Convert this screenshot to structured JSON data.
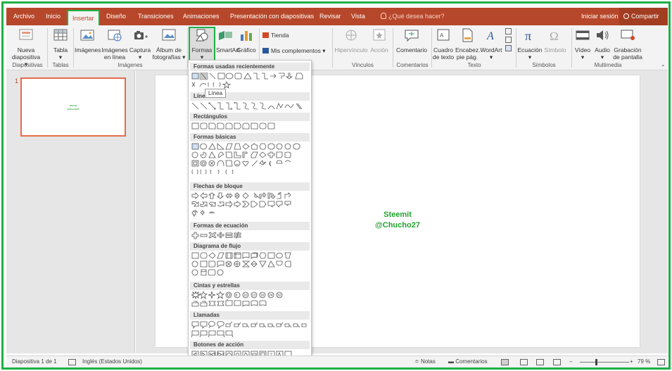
{
  "tabs": [
    "Archivo",
    "Inicio",
    "Insertar",
    "Diseño",
    "Transiciones",
    "Animaciones",
    "Presentación con diapositivas",
    "Revisar",
    "Vista"
  ],
  "active_tab": "Insertar",
  "tell_me": "¿Qué desea hacer?",
  "sign_in": "Iniciar sesión",
  "share": "Compartir",
  "ribbon": {
    "nueva": [
      "Nueva",
      "diapositiva ▾"
    ],
    "tabla": [
      "Tabla",
      "▾"
    ],
    "imagenes": "Imágenes",
    "imagenes_linea": [
      "Imágenes",
      "en línea"
    ],
    "captura": [
      "Captura",
      "▾"
    ],
    "album": [
      "Álbum de",
      "fotografías ▾"
    ],
    "formas": [
      "Formas",
      "▾"
    ],
    "smartart": "SmartArt",
    "grafico": "Gráfico",
    "tienda": "Tienda",
    "mis_complementos": "Mis complementos",
    "hipervinculo": "Hipervínculo",
    "accion": "Acción",
    "comentario": "Comentario",
    "cuadro_texto": [
      "Cuadro",
      "de texto"
    ],
    "encabez": [
      "Encabez.",
      "pie pág."
    ],
    "wordart": [
      "WordArt",
      "▾"
    ],
    "ecuacion": [
      "Ecuación",
      "▾"
    ],
    "simbolo": "Símbolo",
    "video": [
      "Vídeo",
      "▾"
    ],
    "audio": [
      "Audio",
      "▾"
    ],
    "grabacion": [
      "Grabación",
      "de pantalla"
    ],
    "groups": [
      "Diapositivas",
      "Tablas",
      "Imágenes",
      "Vínculos",
      "Comentarios",
      "Texto",
      "Símbolos",
      "Multimedia"
    ]
  },
  "slide_number": "1",
  "slide_text": [
    "Steemit",
    "@Chucho27"
  ],
  "shapes_menu": {
    "sections": [
      "Formas usadas recientemente",
      "Líneas",
      "Rectángulos",
      "Formas básicas",
      "Flechas de bloque",
      "Formas de ecuación",
      "Diagrama de flujo",
      "Cintas y estrellas",
      "Llamadas",
      "Botones de acción"
    ],
    "tooltip": "Línea"
  },
  "status": {
    "slide": "Diapositiva 1 de 1",
    "language": "Inglés (Estados Unidos)",
    "notes": "Notas",
    "comments": "Comentarios",
    "zoom": "79 %"
  },
  "colors": {
    "accent": "#b7472a",
    "highlight": "#1db045"
  }
}
